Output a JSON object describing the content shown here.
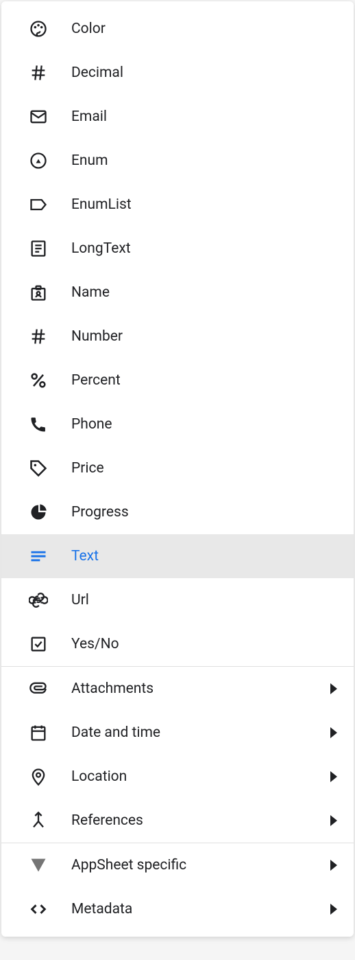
{
  "menu": {
    "section1": [
      {
        "icon": "palette-icon",
        "label": "Color"
      },
      {
        "icon": "hash-icon",
        "label": "Decimal"
      },
      {
        "icon": "email-icon",
        "label": "Email"
      },
      {
        "icon": "clock-icon",
        "label": "Enum"
      },
      {
        "icon": "tag-outline-icon",
        "label": "EnumList"
      },
      {
        "icon": "document-icon",
        "label": "LongText"
      },
      {
        "icon": "badge-icon",
        "label": "Name"
      },
      {
        "icon": "hash-icon",
        "label": "Number"
      },
      {
        "icon": "percent-icon",
        "label": "Percent"
      },
      {
        "icon": "phone-icon",
        "label": "Phone"
      },
      {
        "icon": "price-tag-icon",
        "label": "Price"
      },
      {
        "icon": "pie-icon",
        "label": "Progress"
      },
      {
        "icon": "text-icon",
        "label": "Text",
        "selected": true
      },
      {
        "icon": "link-icon",
        "label": "Url"
      },
      {
        "icon": "checkbox-icon",
        "label": "Yes/No"
      }
    ],
    "section2": [
      {
        "icon": "attachment-icon",
        "label": "Attachments",
        "submenu": true
      },
      {
        "icon": "calendar-icon",
        "label": "Date and time",
        "submenu": true
      },
      {
        "icon": "location-icon",
        "label": "Location",
        "submenu": true
      },
      {
        "icon": "merge-icon",
        "label": "References",
        "submenu": true
      }
    ],
    "section3": [
      {
        "icon": "appsheet-icon",
        "label": "AppSheet specific",
        "submenu": true
      },
      {
        "icon": "code-icon",
        "label": "Metadata",
        "submenu": true
      }
    ]
  }
}
